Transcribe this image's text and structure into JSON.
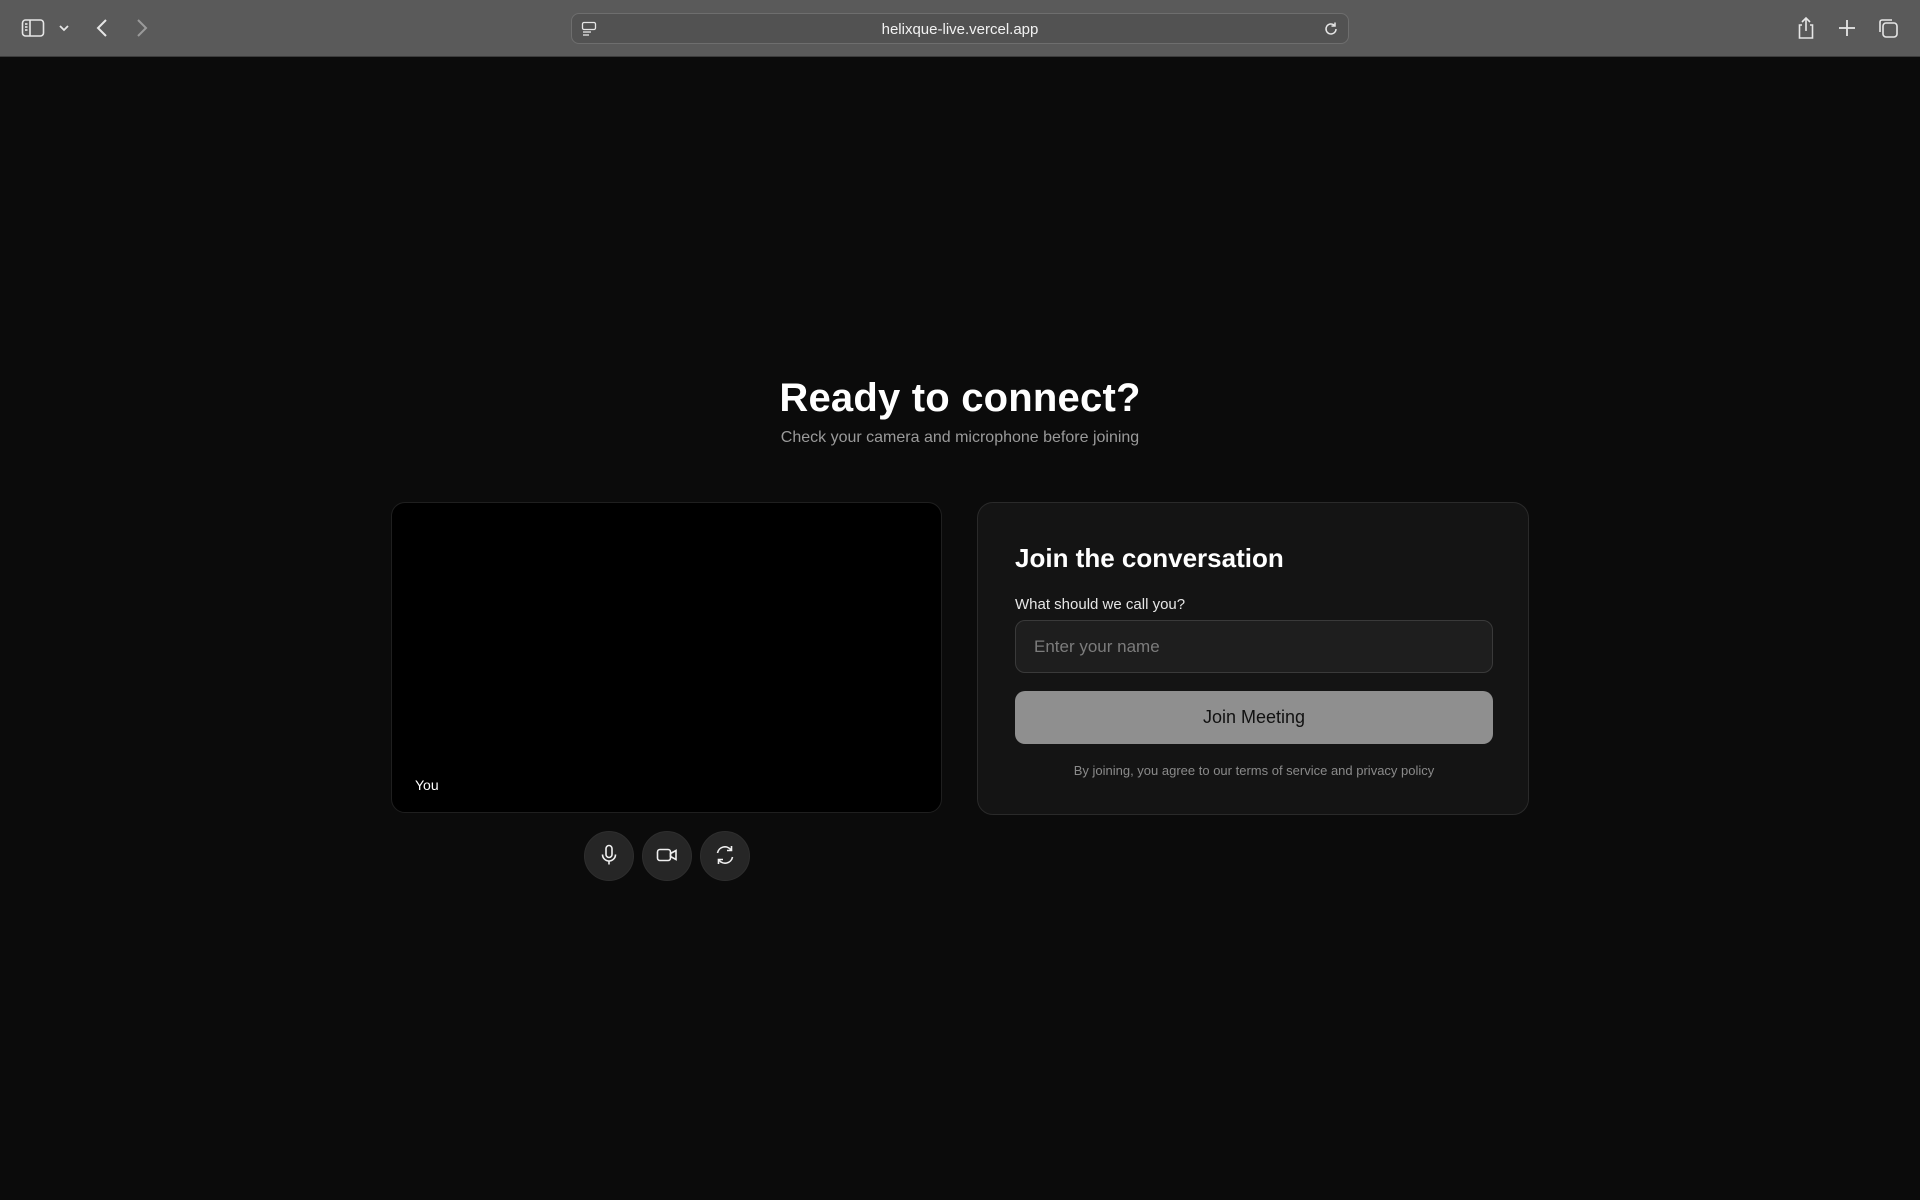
{
  "browser": {
    "url": "helixque-live.vercel.app"
  },
  "hero": {
    "title": "Ready to connect?",
    "subtitle": "Check your camera and microphone before joining"
  },
  "preview": {
    "label": "You"
  },
  "controls": {
    "icons": [
      "microphone-icon",
      "video-camera-icon",
      "switch-camera-icon"
    ]
  },
  "join_card": {
    "title": "Join the conversation",
    "name_label": "What should we call you?",
    "name_placeholder": "Enter your name",
    "name_value": "",
    "button_label": "Join Meeting",
    "terms": "By joining, you agree to our terms of service and privacy policy"
  },
  "colors": {
    "page_bg": "#0b0b0b",
    "toolbar_bg": "#5a5a5a",
    "card_bg": "#141414",
    "button_bg": "#8f8f8f"
  }
}
